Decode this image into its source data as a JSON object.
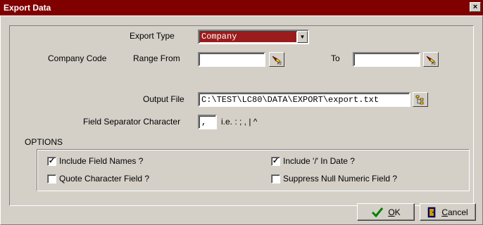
{
  "window": {
    "title": "Export Data",
    "close_glyph": "×"
  },
  "export_type": {
    "label": "Export Type",
    "value": "Company"
  },
  "company_code": {
    "label": "Company Code",
    "range_from_label": "Range From",
    "range_from_value": "",
    "to_label": "To",
    "to_value": ""
  },
  "output_file": {
    "label": "Output File",
    "value": "C:\\TEST\\LC80\\DATA\\EXPORT\\export.txt"
  },
  "separator": {
    "label": "Field Separator Character",
    "value": ",",
    "hint": "i.e. : ; , | ^"
  },
  "options": {
    "heading": "OPTIONS",
    "items": [
      {
        "label": "Include Field Names ?",
        "checked": true
      },
      {
        "label": "Include '/' In Date ?",
        "checked": true
      },
      {
        "label": "Quote Character Field ?",
        "checked": false
      },
      {
        "label": "Suppress Null Numeric Field ?",
        "checked": false
      }
    ]
  },
  "buttons": {
    "ok": {
      "mnemonic": "O",
      "rest": "K",
      "icon": "checkmark-icon"
    },
    "cancel": {
      "mnemonic": "C",
      "rest": "ancel",
      "icon": "door-exit-icon"
    }
  },
  "colors": {
    "title_bar": "#800000",
    "face": "#d4d0c8",
    "combo_highlight": "#9b1c1c"
  }
}
